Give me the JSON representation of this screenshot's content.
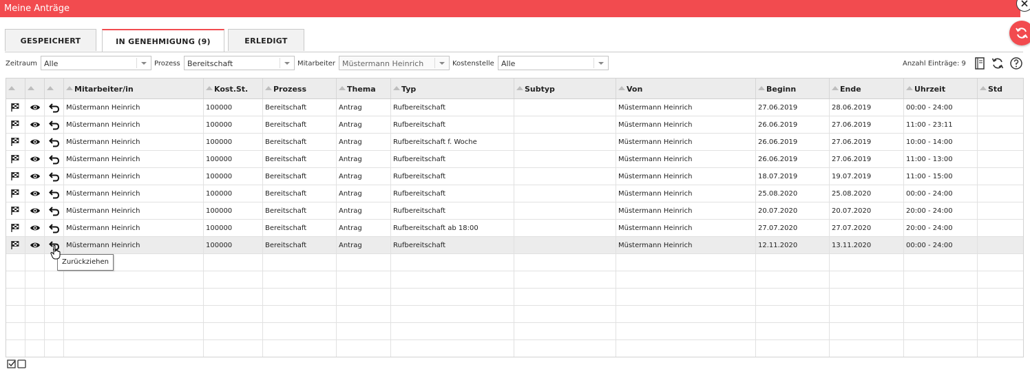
{
  "window": {
    "title": "Meine Anträge"
  },
  "tabs": [
    {
      "label": "GESPEICHERT"
    },
    {
      "label": "IN GENEHMIGUNG (9)"
    },
    {
      "label": "ERLEDIGT"
    }
  ],
  "filters": {
    "zeitraum": {
      "label": "Zeitraum",
      "value": "Alle"
    },
    "prozess": {
      "label": "Prozess",
      "value": "Bereitschaft"
    },
    "mitarbeiter": {
      "label": "Mitarbeiter",
      "value": "Müstermann Heinrich"
    },
    "kostenstelle": {
      "label": "Kostenstelle",
      "value": "Alle"
    }
  },
  "toolbar": {
    "count_label": "Anzahl Einträge: 9",
    "icons": [
      "notebook-icon",
      "refresh-icon",
      "help-icon"
    ]
  },
  "colors": {
    "accent": "#f24b4f",
    "header_bg": "#ececec",
    "selected_row": "#ececec"
  },
  "table": {
    "columns": [
      "Mitarbeiter/in",
      "Kost.St.",
      "Prozess",
      "Thema",
      "Typ",
      "Subtyp",
      "Von",
      "Beginn",
      "Ende",
      "Uhrzeit",
      "Std"
    ],
    "rows": [
      [
        "Müstermann Heinrich",
        "100000",
        "Bereitschaft",
        "Antrag",
        "Rufbereitschaft",
        "",
        "Müstermann Heinrich",
        "27.06.2019",
        "28.06.2019",
        "00:00 - 24:00",
        ""
      ],
      [
        "Müstermann Heinrich",
        "100000",
        "Bereitschaft",
        "Antrag",
        "Rufbereitschaft",
        "",
        "Müstermann Heinrich",
        "26.06.2019",
        "27.06.2019",
        "11:00 - 23:11",
        ""
      ],
      [
        "Müstermann Heinrich",
        "100000",
        "Bereitschaft",
        "Antrag",
        "Rufbereitschaft f. Woche",
        "",
        "Müstermann Heinrich",
        "26.06.2019",
        "27.06.2019",
        "10:00 - 14:00",
        ""
      ],
      [
        "Müstermann Heinrich",
        "100000",
        "Bereitschaft",
        "Antrag",
        "Rufbereitschaft",
        "",
        "Müstermann Heinrich",
        "26.06.2019",
        "27.06.2019",
        "11:00 - 13:00",
        ""
      ],
      [
        "Müstermann Heinrich",
        "100000",
        "Bereitschaft",
        "Antrag",
        "Rufbereitschaft",
        "",
        "Müstermann Heinrich",
        "18.07.2019",
        "19.07.2019",
        "11:00 - 15:00",
        ""
      ],
      [
        "Müstermann Heinrich",
        "100000",
        "Bereitschaft",
        "Antrag",
        "Rufbereitschaft",
        "",
        "Müstermann Heinrich",
        "25.08.2020",
        "25.08.2020",
        "00:00 - 24:00",
        ""
      ],
      [
        "Müstermann Heinrich",
        "100000",
        "Bereitschaft",
        "Antrag",
        "Rufbereitschaft",
        "",
        "Müstermann Heinrich",
        "20.07.2020",
        "20.07.2020",
        "20:00 - 24:00",
        ""
      ],
      [
        "Müstermann Heinrich",
        "100000",
        "Bereitschaft",
        "Antrag",
        "Rufbereitschaft ab 18:00",
        "",
        "Müstermann Heinrich",
        "27.07.2020",
        "27.07.2020",
        "20:00 - 24:00",
        ""
      ],
      [
        "Müstermann Heinrich",
        "100000",
        "Bereitschaft",
        "Antrag",
        "Rufbereitschaft",
        "",
        "Müstermann Heinrich",
        "12.11.2020",
        "13.11.2020",
        "00:00 - 24:00",
        ""
      ]
    ],
    "selected_row": 8,
    "empty_rows": 6
  },
  "tooltip": {
    "text": "Zurückziehen"
  }
}
